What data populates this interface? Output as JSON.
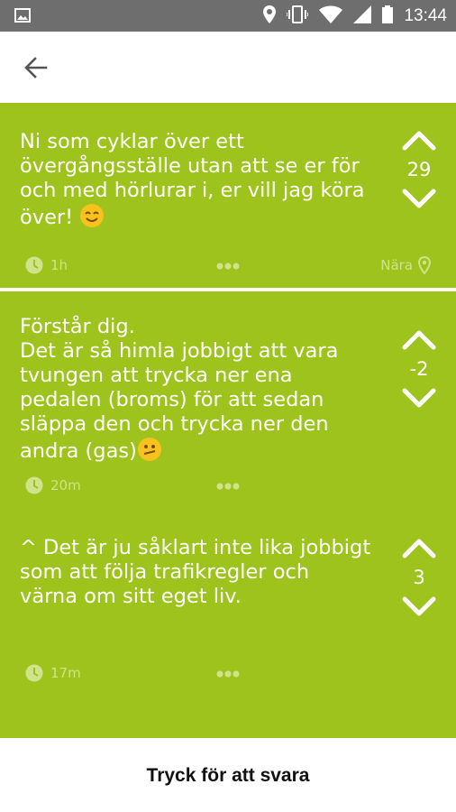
{
  "status_bar": {
    "time": "13:44"
  },
  "colors": {
    "card": "#9ec31c",
    "meta": "#cfe38a",
    "statusbar": "#6e6e6e"
  },
  "posts": [
    {
      "text": "Ni som cyklar över ett\növergångsställe utan att se er för\noch med hörlurar i, er vill jag köra\növer!",
      "emoji": "smiling-face",
      "score": "29",
      "time": "1h",
      "location": "Nära"
    },
    {
      "text": "Förstår dig.\nDet är så himla jobbigt att vara\ntvungen att trycka ner ena\npedalen (broms) för att sedan\nsläppa den och trycka ner den\nandra (gas)",
      "emoji": "confused-face",
      "score": "-2",
      "time": "20m"
    },
    {
      "text": "^ Det är ju såklart inte lika jobbigt\nsom att följa trafikregler och\nvärna om sitt eget liv.",
      "score": "3",
      "time": "17m"
    }
  ],
  "reply_bar": {
    "label": "Tryck för att svara"
  }
}
